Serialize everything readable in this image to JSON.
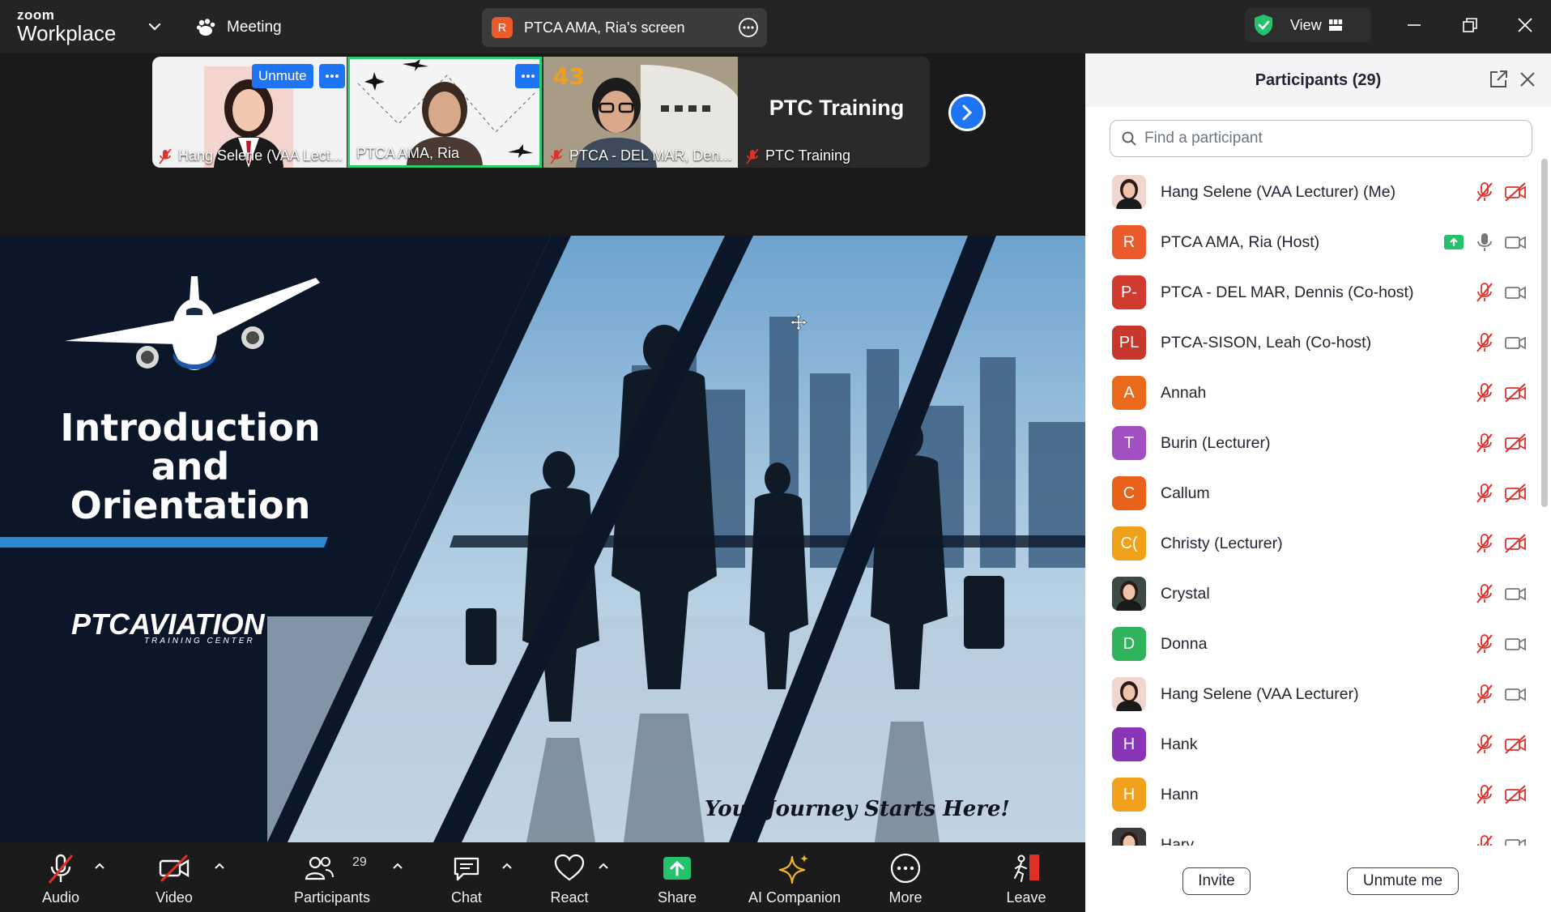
{
  "titlebar": {
    "brand_small": "zoom",
    "brand_large": "Workplace",
    "meeting_label": "Meeting",
    "screen_share_initial": "R",
    "screen_share_label": "PTCA AMA, Ria's screen",
    "view_label": "View",
    "icons": [
      "chevron-down-icon",
      "paw-icon",
      "more-icon",
      "shield-check-icon",
      "grid-icon",
      "minimize-icon",
      "restore-icon",
      "close-icon"
    ]
  },
  "video_strip": {
    "tiles": [
      {
        "name": "Hang Selene (VAA Lect...",
        "muted": true,
        "overlay_button": "Unmute"
      },
      {
        "name": "PTCA AMA, Ria",
        "muted": false,
        "active_speaker": true
      },
      {
        "name": "PTCA - DEL MAR, Den...",
        "muted": true
      },
      {
        "name": "PTC Training",
        "muted": true,
        "title_text": "PTC Training"
      }
    ],
    "next_icon": "chevron-right-icon"
  },
  "slide": {
    "title_line1": "Introduction",
    "title_line2": "and",
    "title_line3": "Orientation",
    "logo_text": "PTCAVIATION",
    "logo_subtext": "TRAINING CENTER",
    "tagline": "Your Journey Starts Here!"
  },
  "toolbar": {
    "audio": "Audio",
    "video": "Video",
    "participants": "Participants",
    "participants_count": "29",
    "chat": "Chat",
    "react": "React",
    "share": "Share",
    "ai_companion": "AI Companion",
    "more": "More",
    "leave": "Leave"
  },
  "participants_panel": {
    "title": "Participants (29)",
    "search_placeholder": "Find a participant",
    "invite_label": "Invite",
    "unmute_me_label": "Unmute me",
    "participants": [
      {
        "name": "Hang Selene (VAA Lecturer) (Me)",
        "initials": "",
        "avatar_color": "#f1d6cf",
        "photo": true,
        "mic_muted": true,
        "video_off": true,
        "sharing": false
      },
      {
        "name": "PTCA AMA, Ria (Host)",
        "initials": "R",
        "avatar_color": "#ea5a2a",
        "photo": false,
        "mic_muted": false,
        "video_off": false,
        "sharing": true
      },
      {
        "name": "PTCA - DEL MAR, Dennis (Co-host)",
        "initials": "P-",
        "avatar_color": "#d13a2f",
        "photo": false,
        "mic_muted": true,
        "video_off": false,
        "sharing": false
      },
      {
        "name": "PTCA-SISON, Leah (Co-host)",
        "initials": "PL",
        "avatar_color": "#c8372c",
        "photo": false,
        "mic_muted": true,
        "video_off": false,
        "sharing": false
      },
      {
        "name": "Annah",
        "initials": "A",
        "avatar_color": "#ea6a1c",
        "photo": false,
        "mic_muted": true,
        "video_off": true,
        "sharing": false
      },
      {
        "name": "Burin (Lecturer)",
        "initials": "T",
        "avatar_color": "#a24fc2",
        "photo": false,
        "mic_muted": true,
        "video_off": true,
        "sharing": false
      },
      {
        "name": "Callum",
        "initials": "C",
        "avatar_color": "#e8621a",
        "photo": false,
        "mic_muted": true,
        "video_off": true,
        "sharing": false
      },
      {
        "name": "Christy (Lecturer)",
        "initials": "C(",
        "avatar_color": "#f0a11a",
        "photo": false,
        "mic_muted": true,
        "video_off": true,
        "sharing": false
      },
      {
        "name": "Crystal",
        "initials": "",
        "avatar_color": "#3c4a44",
        "photo": true,
        "mic_muted": true,
        "video_off": false,
        "sharing": false
      },
      {
        "name": "Donna",
        "initials": "D",
        "avatar_color": "#2fb35b",
        "photo": false,
        "mic_muted": true,
        "video_off": false,
        "sharing": false
      },
      {
        "name": "Hang Selene (VAA Lecturer)",
        "initials": "",
        "avatar_color": "#f1d6cf",
        "photo": true,
        "mic_muted": true,
        "video_off": false,
        "sharing": false
      },
      {
        "name": "Hank",
        "initials": "H",
        "avatar_color": "#8a35b8",
        "photo": false,
        "mic_muted": true,
        "video_off": true,
        "sharing": false
      },
      {
        "name": "Hann",
        "initials": "H",
        "avatar_color": "#f2a11c",
        "photo": false,
        "mic_muted": true,
        "video_off": true,
        "sharing": false
      },
      {
        "name": "Hary",
        "initials": "",
        "avatar_color": "#3a3a3a",
        "photo": true,
        "mic_muted": true,
        "video_off": false,
        "sharing": false
      }
    ]
  },
  "colors": {
    "accent_blue": "#1e74f2",
    "active_speaker_green": "#2ecc71",
    "muted_red": "#e0302a",
    "share_green": "#23c26b"
  }
}
